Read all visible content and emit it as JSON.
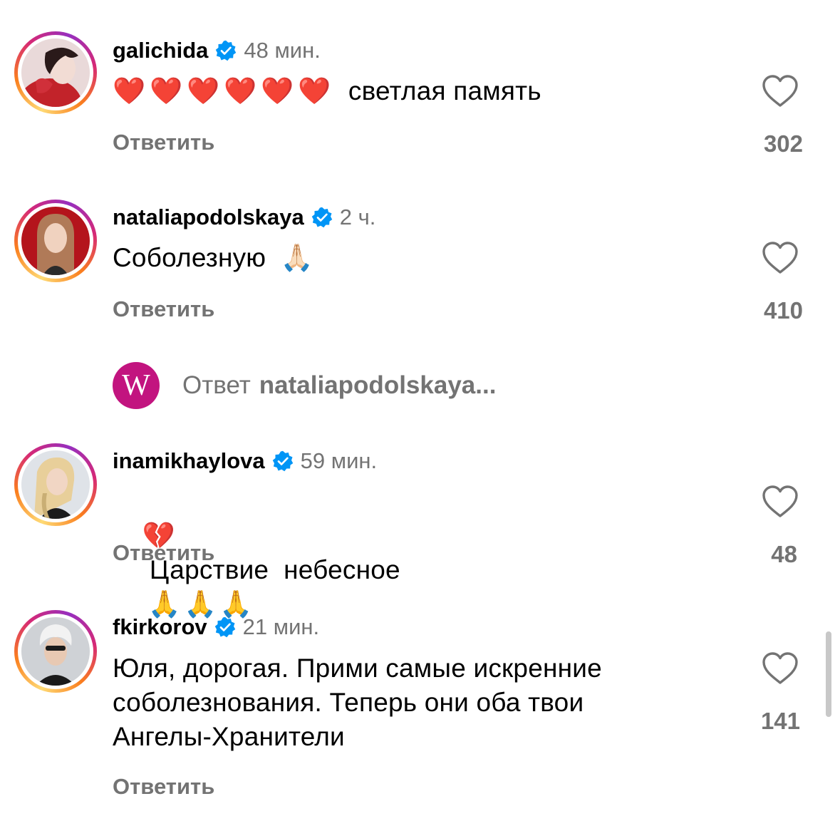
{
  "comments": [
    {
      "username": "galichida",
      "time": "48 мин.",
      "text_emoji": "❤️❤️❤️❤️❤️❤️",
      "text": "светлая память",
      "reply_label": "Ответить",
      "likes": "302",
      "avatar_icon": "avatar-galichida"
    },
    {
      "username": "nataliapodolskaya",
      "time": "2 ч.",
      "text": "Соболезную",
      "text_emoji": "🙏🏻",
      "reply_label": "Ответить",
      "likes": "410",
      "avatar_icon": "avatar-nataliapodolskaya"
    },
    {
      "username": "inamikhaylova",
      "time": "59 мин.",
      "text_emoji_lead": "💔",
      "text": "Царствие  небесное",
      "text_emoji": "🙏🙏🙏",
      "reply_label": "Ответить",
      "likes": "48",
      "avatar_icon": "avatar-inamikhaylova"
    },
    {
      "username": "fkirkorov",
      "time": "21 мин.",
      "text_lines": [
        "Юля, дорогая. Прими самые искренние",
        "соболезнования. Теперь они оба твои",
        "Ангелы-Хранители"
      ],
      "reply_label": "Ответить",
      "likes": "141",
      "avatar_icon": "avatar-fkirkorov"
    }
  ],
  "thread": {
    "logo_letter": "W",
    "prefix": "Ответ",
    "user": "nataliapodolskaya..."
  },
  "colors": {
    "verified": "#0095f6",
    "secondary_text": "#737373",
    "brand_w": "#c2147f"
  }
}
